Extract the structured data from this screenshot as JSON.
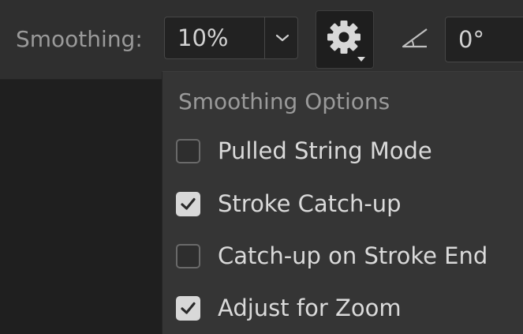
{
  "toolbar": {
    "smoothing_label": "Smoothing:",
    "smoothing_value": "10%",
    "angle_value": "0°",
    "icons": {
      "chevron": "chevron-down-icon",
      "gear": "gear-icon",
      "angle": "angle-icon"
    }
  },
  "smoothing_options": {
    "heading": "Smoothing Options",
    "items": [
      {
        "label": "Pulled String Mode",
        "checked": false
      },
      {
        "label": "Stroke Catch-up",
        "checked": true
      },
      {
        "label": "Catch-up on Stroke End",
        "checked": false
      },
      {
        "label": "Adjust for Zoom",
        "checked": true
      }
    ]
  },
  "colors": {
    "bar_background": "#2f2f2f",
    "panel_background": "#353535",
    "text": "#dadada",
    "muted_text": "#9a9a9a"
  }
}
